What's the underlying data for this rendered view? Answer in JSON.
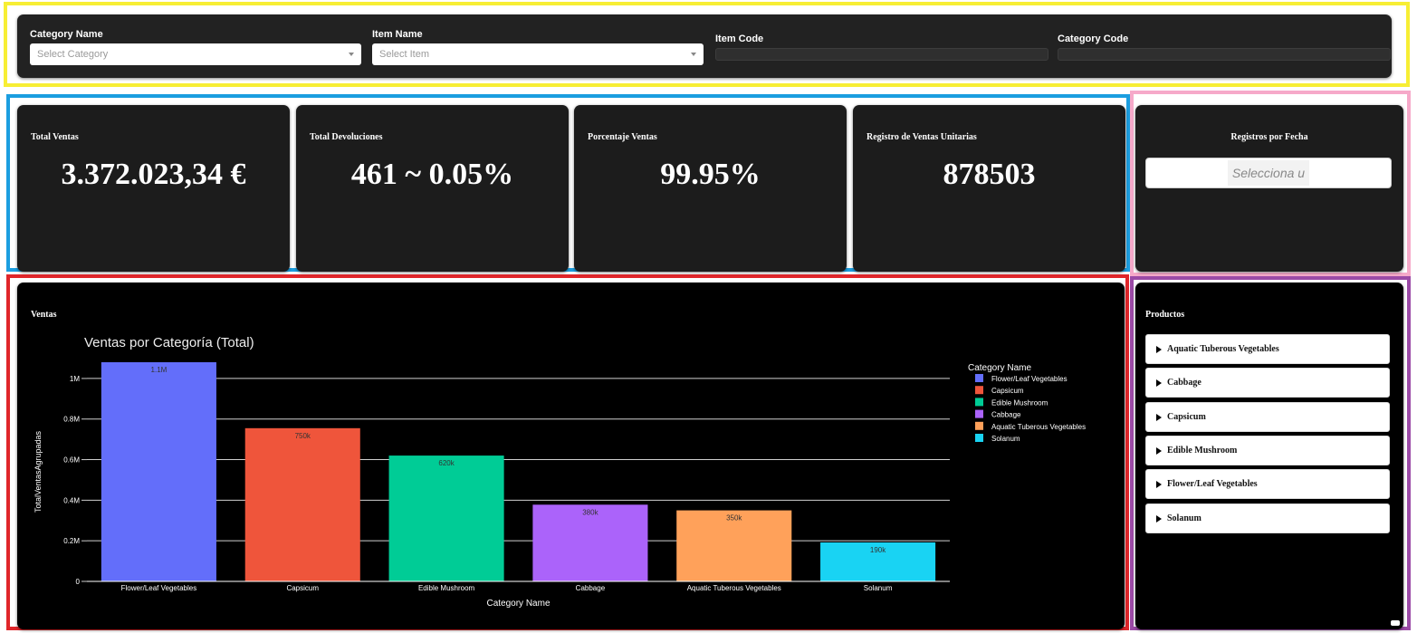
{
  "filters": {
    "category_name_label": "Category Name",
    "category_name_placeholder": "Select Category",
    "item_name_label": "Item Name",
    "item_name_placeholder": "Select Item",
    "item_code_label": "Item Code",
    "category_code_label": "Category Code"
  },
  "kpis": [
    {
      "title": "Total Ventas",
      "value": "3.372.023,34 €"
    },
    {
      "title": "Total Devoluciones",
      "value": "461 ~ 0.05%"
    },
    {
      "title": "Porcentaje Ventas",
      "value": "99.95%"
    },
    {
      "title": "Registro de Ventas Unitarias",
      "value": "878503"
    }
  ],
  "date_filter": {
    "title": "Registros por Fecha",
    "placeholder": "Selecciona u"
  },
  "ventas": {
    "section_title": "Ventas"
  },
  "productos": {
    "section_title": "Productos",
    "items": [
      "Aquatic Tuberous Vegetables",
      "Cabbage",
      "Capsicum",
      "Edible Mushroom",
      "Flower/Leaf Vegetables",
      "Solanum"
    ]
  },
  "chart_data": {
    "type": "bar",
    "title": "Ventas por Categoría (Total)",
    "xlabel": "Category Name",
    "ylabel": "TotalVentasAgrupadas",
    "categories": [
      "Flower/Leaf Vegetables",
      "Capsicum",
      "Edible Mushroom",
      "Cabbage",
      "Aquatic Tuberous Vegetables",
      "Solanum"
    ],
    "values": [
      1080000,
      755000,
      620000,
      378000,
      350000,
      192000
    ],
    "data_labels": [
      "1.1M",
      "750k",
      "620k",
      "380k",
      "350k",
      "190k"
    ],
    "colors": [
      "#636efa",
      "#ef553b",
      "#00cc96",
      "#ab63fa",
      "#ffa15a",
      "#19d3f3"
    ],
    "yticks": [
      0,
      200000,
      400000,
      600000,
      800000,
      1000000
    ],
    "ytick_labels": [
      "0",
      "0.2M",
      "0.4M",
      "0.6M",
      "0.8M",
      "1M"
    ],
    "ylim": [
      0,
      1080000
    ],
    "grid": true,
    "legend": {
      "title": "Category Name",
      "position": "right"
    }
  }
}
